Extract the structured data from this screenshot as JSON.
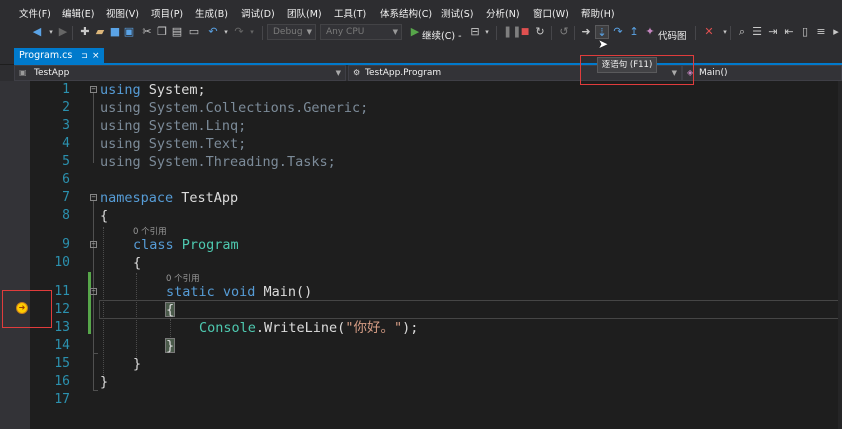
{
  "menu": [
    "文件(F)",
    "编辑(E)",
    "视图(V)",
    "项目(P)",
    "生成(B)",
    "调试(D)",
    "团队(M)",
    "工具(T)",
    "体系结构(C)",
    "测试(S)",
    "分析(N)",
    "窗口(W)",
    "帮助(H)"
  ],
  "toolbar": {
    "config": "Debug",
    "platform": "Any CPU",
    "continue_label": "继续(C) -",
    "codemap_label": "代码图",
    "tooltip": "逐语句 (F11)"
  },
  "tab": {
    "name": "Program.cs",
    "pin": "⊐",
    "close": "×"
  },
  "nav": {
    "project": "TestApp",
    "class": "TestApp.Program",
    "member": "Main()"
  },
  "editor": {
    "line_numbers": [
      "1",
      "2",
      "3",
      "4",
      "5",
      "6",
      "7",
      "8",
      "9",
      "10",
      "11",
      "12",
      "13",
      "14",
      "15",
      "16",
      "17"
    ],
    "codelens": "0 个引用",
    "code": {
      "l1_kw": "using",
      "l1_rest": " System;",
      "l2_kw": "using",
      "l2_rest": " System.Collections.Generic;",
      "l3_kw": "using",
      "l3_rest": " System.Linq;",
      "l4_kw": "using",
      "l4_rest": " System.Text;",
      "l5_kw": "using",
      "l5_rest": " System.Threading.Tasks;",
      "l7_kw": "namespace",
      "l7_rest": " TestApp",
      "l8": "{",
      "l9_kw": "class",
      "l9_type": " Program",
      "l10": "{",
      "l11_kw": "static void",
      "l11_rest": " Main()",
      "l12": "{",
      "l13_type": "Console",
      "l13_mid": ".WriteLine(",
      "l13_str": "\"你好。\"",
      "l13_end": ");",
      "l14": "}",
      "l15": "}",
      "l16": "}"
    }
  },
  "colors": {
    "accent": "#007acc",
    "keyword": "#569cd6",
    "type": "#4ec9b0",
    "string": "#d69d85",
    "line_number": "#2b91af",
    "highlight": "#e03c3c",
    "change_bar": "#57a64a",
    "instruction_pointer": "#ffcc00"
  }
}
